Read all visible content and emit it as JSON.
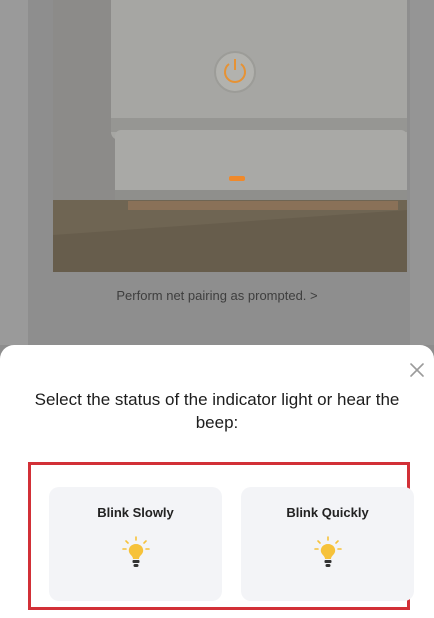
{
  "hint_text": "Perform net pairing as prompted. >",
  "dialog": {
    "title": "Select the status of the indicator light or hear the beep:",
    "options": [
      {
        "label": "Blink Slowly"
      },
      {
        "label": "Blink Quickly"
      }
    ]
  },
  "icons": {
    "close": "close-icon",
    "bulb": "lightbulb-icon",
    "power": "power-icon"
  },
  "colors": {
    "highlight_border": "#d23037",
    "indicator_orange": "#f0892a",
    "bulb_yellow": "#f6c23a",
    "card_bg": "#f3f4f7"
  }
}
